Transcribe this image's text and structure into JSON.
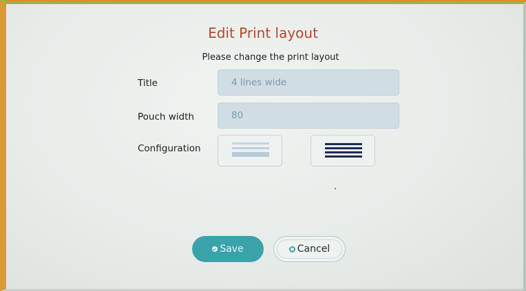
{
  "dialog": {
    "title": "Edit Print layout",
    "subtitle": "Please change the print layout"
  },
  "form": {
    "title_label": "Title",
    "title_value": "4 lines wide",
    "pouch_width_label": "Pouch width",
    "pouch_width_value": "80",
    "configuration_label": "Configuration",
    "configuration_options": [
      "light-lines-icon",
      "dark-lines-icon"
    ]
  },
  "actions": {
    "save_label": "Save",
    "cancel_label": "Cancel"
  },
  "colors": {
    "title": "#b8452d",
    "accent": "#3aa3aa",
    "field_bg": "#d0dde4",
    "field_text": "#7e9aac"
  }
}
